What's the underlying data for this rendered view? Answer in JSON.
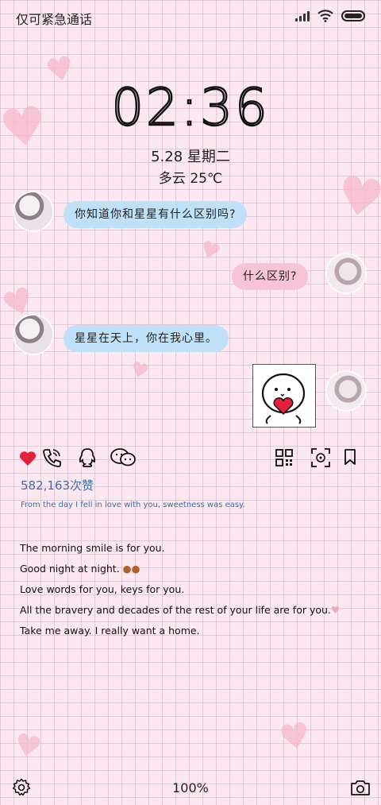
{
  "status_bar": {
    "carrier_text": "仅可紧急通话",
    "icons": [
      "signal-icon",
      "wifi-icon",
      "battery-icon"
    ]
  },
  "lockscreen": {
    "time": "02:36",
    "date": "5.28 星期二",
    "weather": "多云 25℃"
  },
  "chat": {
    "messages": [
      {
        "side": "left",
        "text": "你知道你和星星有什么区别吗?"
      },
      {
        "side": "right",
        "text": "什么区别?"
      },
      {
        "side": "left",
        "text": "星星在天上，你在我心里。"
      },
      {
        "side": "right",
        "sticker": "heart-sticker"
      }
    ]
  },
  "actions": {
    "left": [
      "heart-icon",
      "phone-icon",
      "qq-icon",
      "chat-icon"
    ],
    "right": [
      "qrcode-icon",
      "scan-icon",
      "bookmark-icon"
    ],
    "likes_text": "582,163次赞",
    "tagline": "From the day I fell in love with you, sweetness was easy."
  },
  "poem": {
    "lines": [
      "The morning smile is for you.",
      "Good night at night.",
      "Love words for you, keys for you.",
      "All the bravery and decades of the rest of your life are for you.",
      "Take me away. I really want a home."
    ]
  },
  "bottom_bar": {
    "zoom": "100%",
    "icons": [
      "settings-icon",
      "camera-icon"
    ]
  },
  "colors": {
    "bubble_blue": "#bfe0f6",
    "bubble_pink": "#f6c4d6",
    "heart_red": "#e0223a",
    "link_blue": "#3c6fa5"
  }
}
